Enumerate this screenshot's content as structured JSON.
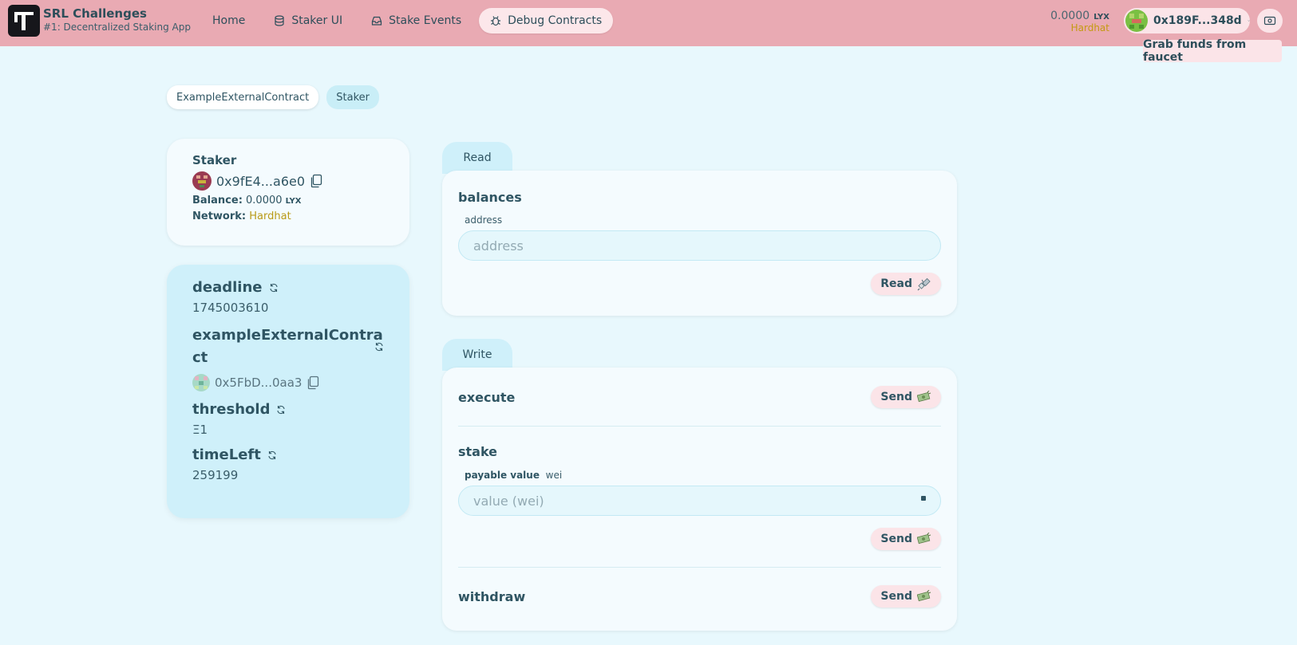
{
  "app": {
    "title": "SRL Challenges",
    "subtitle": "#1: Decentralized Staking App"
  },
  "nav": [
    {
      "label": "Home",
      "icon": "none"
    },
    {
      "label": "Staker UI",
      "icon": "database-icon"
    },
    {
      "label": "Stake Events",
      "icon": "inbox-icon"
    },
    {
      "label": "Debug Contracts",
      "icon": "bug-icon",
      "active": true
    }
  ],
  "wallet": {
    "balance": "0.0000",
    "unit": "LYX",
    "network": "Hardhat",
    "address": "0x189F...348d",
    "faucet_tooltip": "Grab funds from faucet"
  },
  "contract_tabs": [
    {
      "label": "ExampleExternalContract",
      "active": false
    },
    {
      "label": "Staker",
      "active": true
    }
  ],
  "contract": {
    "name": "Staker",
    "address": "0x9fE4...a6e0",
    "balance_label": "Balance:",
    "balance_value": "0.0000",
    "balance_unit": "LYX",
    "network_label": "Network:",
    "network_value": "Hardhat"
  },
  "variables": {
    "deadline": {
      "label": "deadline",
      "value": "1745003610"
    },
    "example": {
      "label": "exampleExternalContract",
      "label_line1": "exampleExternalContra",
      "label_line2": "ct",
      "value": "0x5FbD...0aa3"
    },
    "threshold": {
      "label": "threshold",
      "value": "Ξ1"
    },
    "timeLeft": {
      "label": "timeLeft",
      "value": "259199"
    }
  },
  "read": {
    "tab": "Read",
    "fn_name": "balances",
    "param_label": "address",
    "placeholder": "address",
    "button": "Read"
  },
  "write": {
    "tab": "Write",
    "execute": {
      "name": "execute",
      "button": "Send"
    },
    "stake": {
      "name": "stake",
      "payable_label": "payable value",
      "unit": "wei",
      "placeholder": "value (wei)",
      "button": "Send"
    },
    "withdraw": {
      "name": "withdraw",
      "button": "Send"
    }
  },
  "colors": {
    "header_bg": "#e9aab3",
    "page_bg": "#e8f8fd",
    "accent_card": "#cff0fa",
    "network": "#c49a11"
  }
}
